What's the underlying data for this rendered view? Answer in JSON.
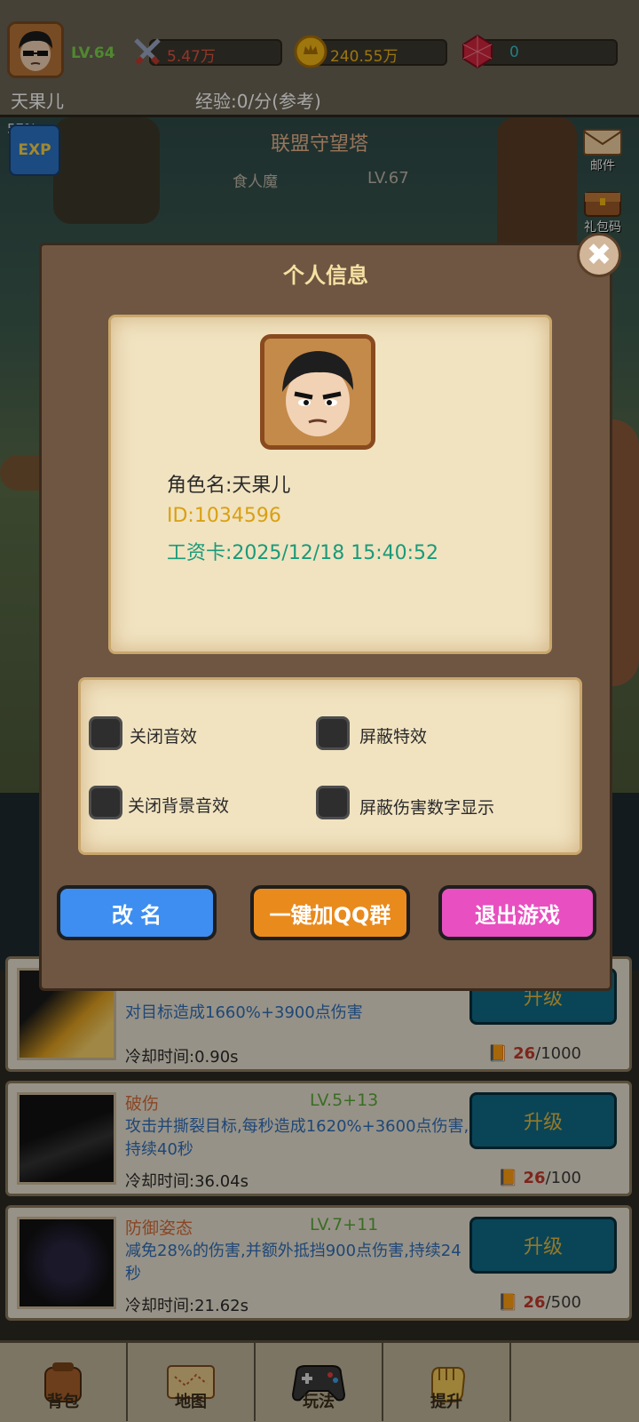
{
  "player": {
    "level": "LV.64",
    "name": "天果儿",
    "exp_rate": "经验:0/分(参考)"
  },
  "resources": {
    "attack": "5.47万",
    "gold": "240.55万",
    "gems": "0"
  },
  "scene": {
    "exp_percent": "57%",
    "exp_badge": "EXP",
    "stage_title": "联盟守望塔",
    "monster_name": "食人魔",
    "monster_level": "LV.67",
    "side_buttons": [
      "邮件",
      "礼包码"
    ]
  },
  "modal": {
    "title": "个人信息",
    "close_symbol": "✖",
    "role_name": "角色名:天果儿",
    "id_text": "ID:1034596",
    "salary_card": "工资卡:2025/12/18 15:40:52",
    "options": [
      {
        "label": "关闭音效",
        "checked": false
      },
      {
        "label": "屏蔽特效",
        "checked": false
      },
      {
        "label": "关闭背景音效",
        "checked": false
      },
      {
        "label": "屏蔽伤害数字显示",
        "checked": false
      }
    ],
    "buttons": {
      "rename": "改 名",
      "join_qq": "一键加QQ群",
      "quit": "退出游戏"
    }
  },
  "skills": [
    {
      "name": "",
      "level": "",
      "desc": "对目标造成1660%+3900点伤害",
      "cooldown": "冷却时间:0.90s",
      "upgrade": "升级",
      "cost_have": "26",
      "cost_need": "/1000"
    },
    {
      "name": "破伤",
      "level": "LV.5+13",
      "desc": "攻击并撕裂目标,每秒造成1620%+3600点伤害,持续40秒",
      "cooldown": "冷却时间:36.04s",
      "upgrade": "升级",
      "cost_have": "26",
      "cost_need": "/100"
    },
    {
      "name": "防御姿态",
      "level": "LV.7+11",
      "desc": "减免28%的伤害,并额外抵挡900点伤害,持续24秒",
      "cooldown": "冷却时间:21.62s",
      "upgrade": "升级",
      "cost_have": "26",
      "cost_need": "/500"
    }
  ],
  "nav": {
    "items": [
      "背包",
      "地图",
      "玩法",
      "提升"
    ]
  },
  "colors": {
    "accent_blue": "#3d8ef0",
    "accent_orange": "#e98a1d",
    "accent_pink": "#e84fc0",
    "panel_brown": "#6e5642",
    "parchment": "#f1e3c0"
  }
}
